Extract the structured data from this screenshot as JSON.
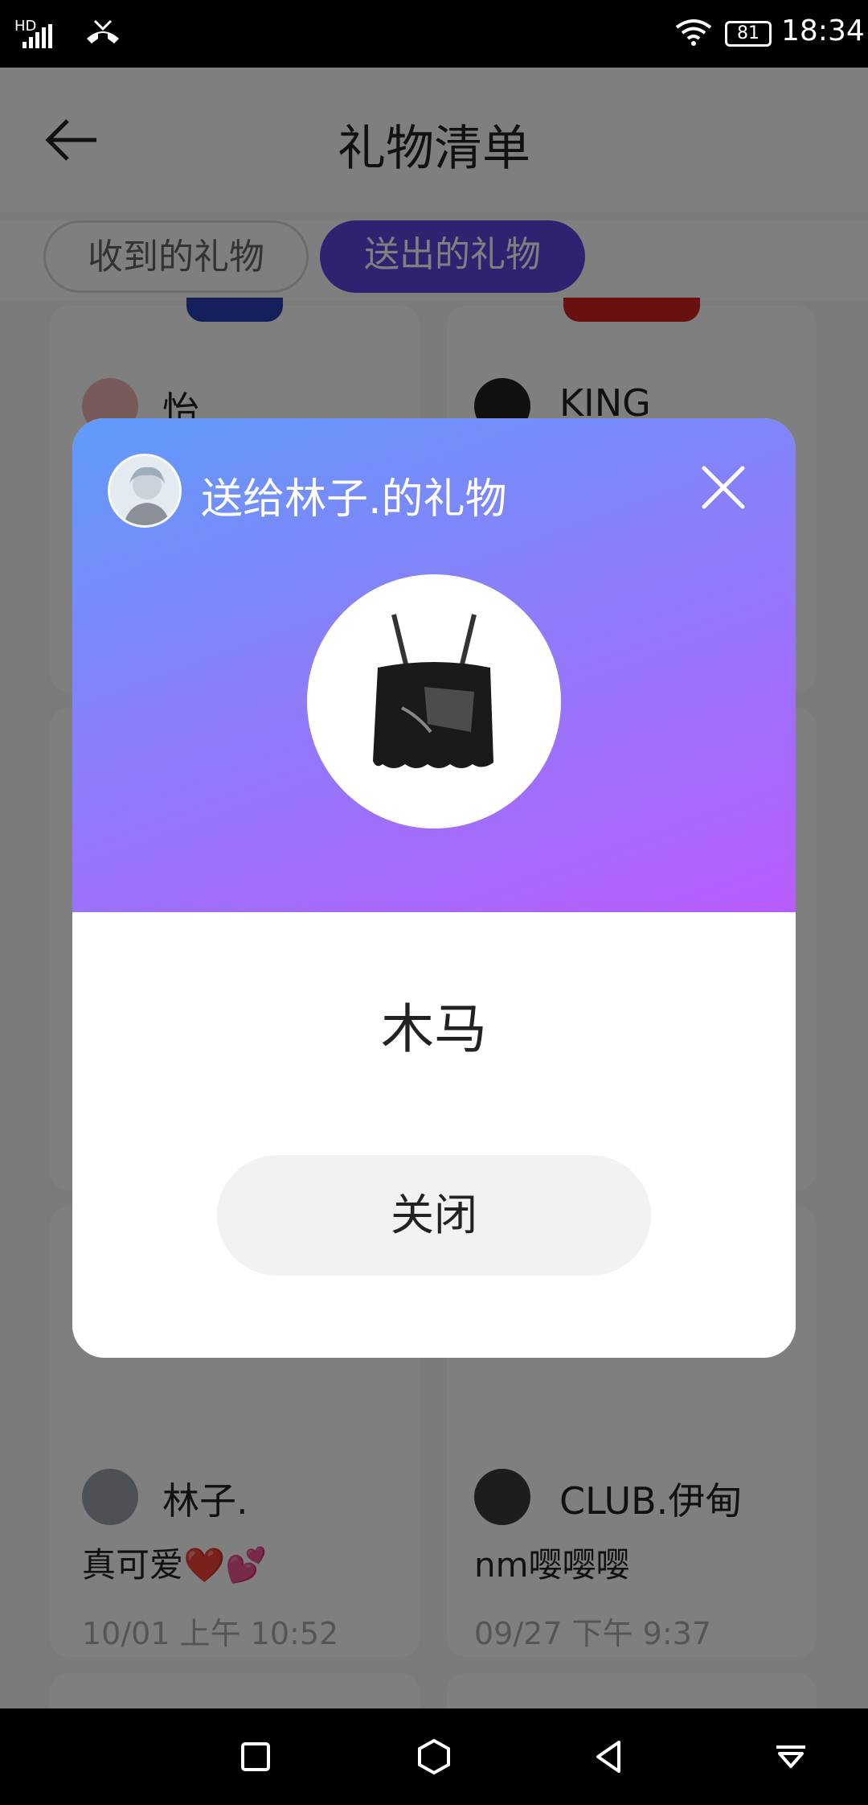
{
  "status_bar": {
    "network": "HD",
    "battery": "81",
    "time": "18:34"
  },
  "header": {
    "title": "礼物清单"
  },
  "tabs": [
    {
      "label": "收到的礼物",
      "active": false
    },
    {
      "label": "送出的礼物",
      "active": true
    }
  ],
  "cards": [
    {
      "name": "怡",
      "message": "",
      "time": ""
    },
    {
      "name": "KING",
      "message": "",
      "time": ""
    },
    {
      "name": "林子.",
      "message": "真可爱❤️💕",
      "time": "10/01 上午 10:52"
    },
    {
      "name": "CLUB.伊甸",
      "message": "nm嘤嘤嘤",
      "time": "09/27 下午 9:37"
    }
  ],
  "dialog": {
    "title": "送给林子.的礼物",
    "gift_name": "木马",
    "close_label": "关闭"
  },
  "colors": {
    "accent": "#5a46e0",
    "gradient_start": "#5f9cfb",
    "gradient_end": "#b85cfc"
  }
}
